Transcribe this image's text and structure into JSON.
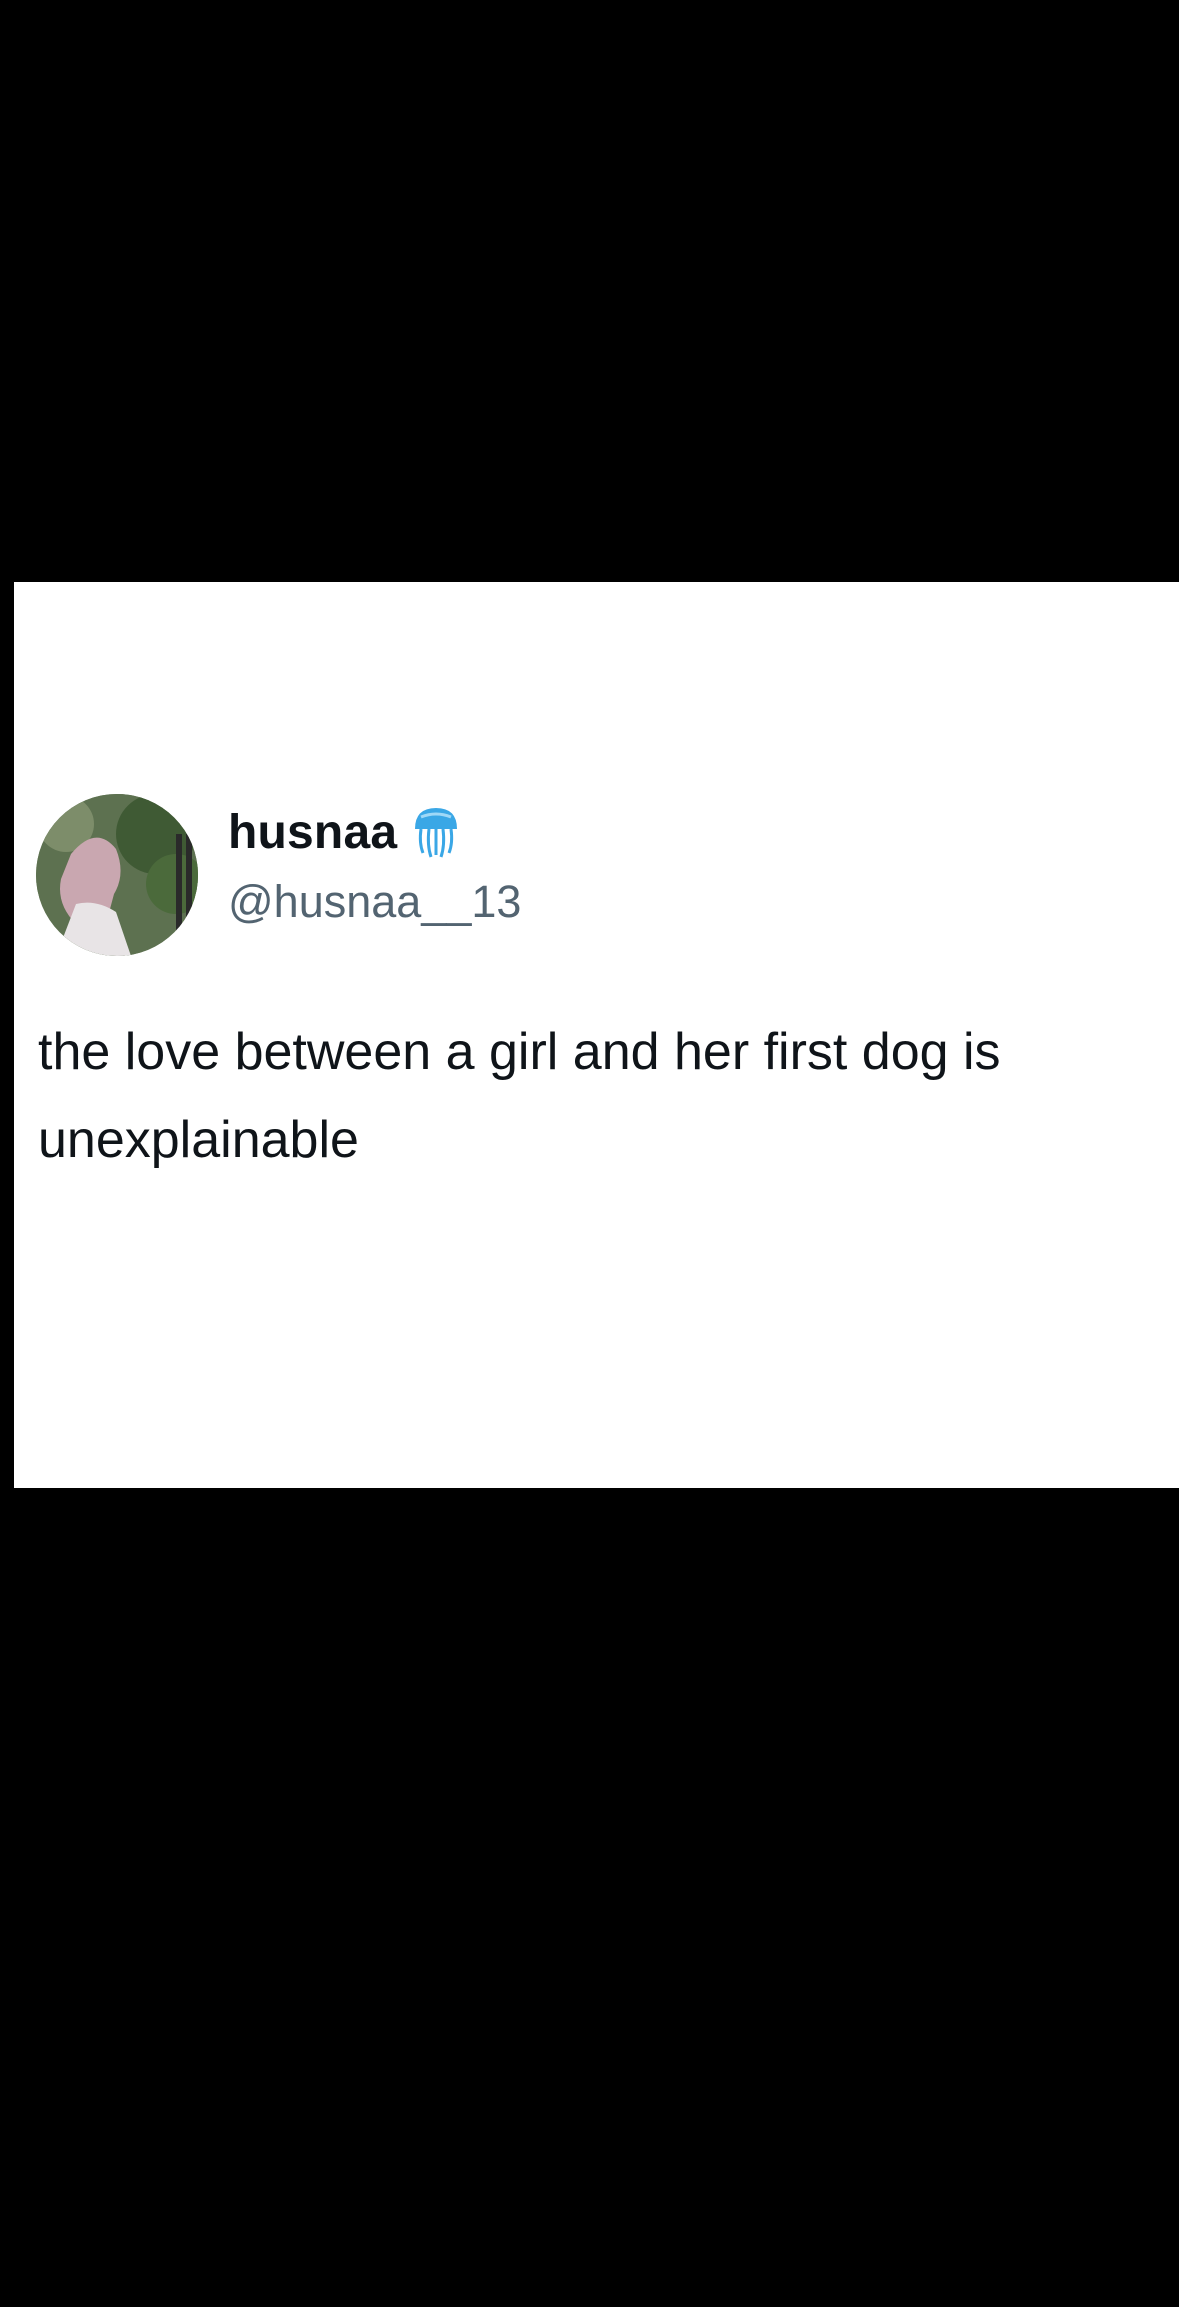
{
  "tweet": {
    "display_name": "husnaa",
    "badge_icon": "jellyfish-icon",
    "handle": "@husnaa__13",
    "text": "the love between a girl and her first dog is\nunexplainable",
    "avatar": "avatar"
  },
  "colors": {
    "background": "#000000",
    "card": "#ffffff",
    "name": "#0f1419",
    "handle": "#536471",
    "badge": "#3aa7e6"
  }
}
